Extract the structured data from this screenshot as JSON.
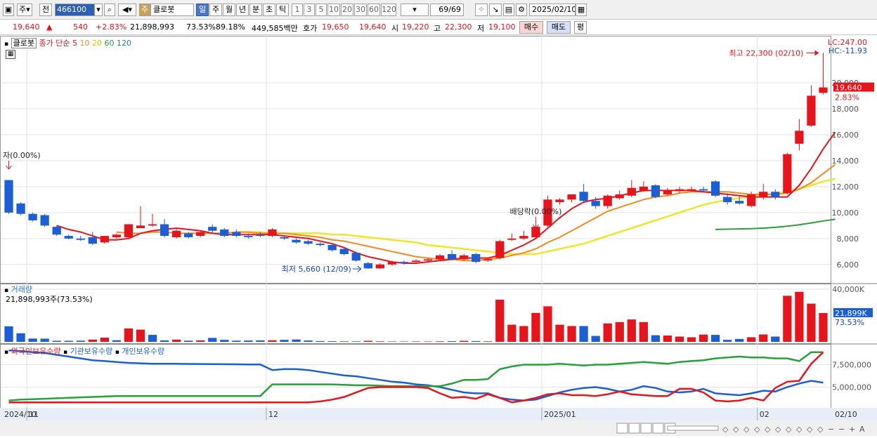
{
  "toolbar": {
    "type_label": "주",
    "prev_label": "전",
    "code": "466100",
    "stock_badge": "주",
    "stock_name": "클로봇",
    "periods": [
      "일",
      "주",
      "월",
      "년",
      "분",
      "초",
      "틱"
    ],
    "active_period": "일",
    "intervals": [
      "1",
      "3",
      "5",
      "10",
      "20",
      "30",
      "60",
      "120"
    ],
    "count": "69/69",
    "date": "2025/02/10"
  },
  "quote": {
    "price": "19,640",
    "change_arrow": "▲",
    "change": "540",
    "change_pct": "+2.83%",
    "volume": "21,898,993",
    "turnover_pct": "73.53%",
    "ratio": "89.18%",
    "amount": "449,585백만",
    "ask_label": "호가",
    "ask1": "19,650",
    "ask2": "19,640",
    "open_label": "시",
    "open": "19,220",
    "high_label": "고",
    "high": "22,300",
    "low_label": "저",
    "low": "19,100",
    "buy_label": "매수",
    "sell_label": "매도",
    "avg_label": "평"
  },
  "price_panel": {
    "name_label": "클로봇",
    "ma_title": "종가 단순",
    "ma_periods": [
      "5",
      "10",
      "20",
      "60",
      "120"
    ],
    "lc_label": "LC:247.00",
    "hc_label": "HC:-11.93",
    "high_annot": "최고 22,300 (02/10)",
    "low_annot": "최저 5,660 (12/09)",
    "start_annot": "자(0.00%)",
    "div_annot": "배당락(0.00%)",
    "last_price_tag": "19,640",
    "last_pct_tag": "2.83%"
  },
  "volume_panel": {
    "title": "거래량",
    "value_label": "21,898,993주(73.53%)",
    "axis_max": "40,000K",
    "last_tag": "21,899K",
    "last_pct": "73.53%"
  },
  "holding_panel": {
    "series_names": [
      "외국인보유수량",
      "기관보유수량",
      "개인보유수량"
    ]
  },
  "x_axis": {
    "labels": [
      "2024/10",
      "11",
      "12",
      "2025/01",
      "02",
      "02/10"
    ]
  },
  "colors": {
    "up": "#e8141c",
    "down": "#1a5fd6",
    "ma5": "#e8141c",
    "ma10": "#f08c1e",
    "ma20": "#f0e628",
    "ma60": "#28a03c",
    "ma120": "#1e78c8"
  },
  "chart_data": [
    {
      "type": "candlestick",
      "title": "클로봇",
      "ylim": [
        4800,
        23400
      ],
      "y_ticks": [
        6000,
        8000,
        10000,
        12000,
        14000,
        16000,
        18000,
        20000
      ],
      "candles": [
        {
          "o": 12500,
          "h": 12500,
          "c": 10000,
          "l": 9900
        },
        {
          "o": 10700,
          "h": 10800,
          "c": 9900,
          "l": 9800
        },
        {
          "o": 9900,
          "h": 10000,
          "c": 9400,
          "l": 9300
        },
        {
          "o": 9800,
          "h": 9900,
          "c": 9000,
          "l": 8900
        },
        {
          "o": 8900,
          "h": 9000,
          "c": 8300,
          "l": 8200
        },
        {
          "o": 8200,
          "h": 8300,
          "c": 8000,
          "l": 7950
        },
        {
          "o": 8000,
          "h": 8200,
          "c": 7900,
          "l": 7800
        },
        {
          "o": 8100,
          "h": 8500,
          "c": 7600,
          "l": 7500
        },
        {
          "o": 7700,
          "h": 8200,
          "c": 8200,
          "l": 7600
        },
        {
          "o": 8100,
          "h": 8400,
          "c": 8300,
          "l": 8000
        },
        {
          "o": 8100,
          "h": 8500,
          "c": 9100,
          "l": 8000
        },
        {
          "o": 8800,
          "h": 10500,
          "c": 9000,
          "l": 8800
        },
        {
          "o": 9000,
          "h": 9900,
          "c": 9100,
          "l": 8900
        },
        {
          "o": 9100,
          "h": 9500,
          "c": 8200,
          "l": 8100
        },
        {
          "o": 8100,
          "h": 8700,
          "c": 8600,
          "l": 8000
        },
        {
          "o": 8400,
          "h": 8500,
          "c": 8100,
          "l": 8000
        },
        {
          "o": 8200,
          "h": 8600,
          "c": 8500,
          "l": 8100
        },
        {
          "o": 8900,
          "h": 9100,
          "c": 8600,
          "l": 8400
        },
        {
          "o": 8700,
          "h": 8800,
          "c": 8200,
          "l": 8100
        },
        {
          "o": 8500,
          "h": 8700,
          "c": 8200,
          "l": 8100
        },
        {
          "o": 8200,
          "h": 8400,
          "c": 8100,
          "l": 8000
        },
        {
          "o": 8300,
          "h": 8500,
          "c": 8200,
          "l": 8100
        },
        {
          "o": 8200,
          "h": 8800,
          "c": 8700,
          "l": 8100
        },
        {
          "o": 8100,
          "h": 8200,
          "c": 8000,
          "l": 7900
        },
        {
          "o": 7900,
          "h": 8000,
          "c": 7700,
          "l": 7600
        },
        {
          "o": 7800,
          "h": 7900,
          "c": 7600,
          "l": 7500
        },
        {
          "o": 7600,
          "h": 7700,
          "c": 7500,
          "l": 7400
        },
        {
          "o": 7500,
          "h": 7600,
          "c": 7100,
          "l": 7000
        },
        {
          "o": 7200,
          "h": 7300,
          "c": 6800,
          "l": 6700
        },
        {
          "o": 6900,
          "h": 7000,
          "c": 6300,
          "l": 6200
        },
        {
          "o": 6100,
          "h": 6200,
          "c": 5700,
          "l": 5660
        },
        {
          "o": 5700,
          "h": 6100,
          "c": 6000,
          "l": 5660
        },
        {
          "o": 6000,
          "h": 6300,
          "c": 6200,
          "l": 5900
        },
        {
          "o": 6200,
          "h": 6300,
          "c": 6100,
          "l": 6000
        },
        {
          "o": 6200,
          "h": 6400,
          "c": 6300,
          "l": 6100
        },
        {
          "o": 6300,
          "h": 6500,
          "c": 6400,
          "l": 6200
        },
        {
          "o": 6400,
          "h": 6800,
          "c": 6700,
          "l": 6300
        },
        {
          "o": 6800,
          "h": 7100,
          "c": 6400,
          "l": 6300
        },
        {
          "o": 6400,
          "h": 6800,
          "c": 6700,
          "l": 6300
        },
        {
          "o": 6800,
          "h": 6900,
          "c": 6200,
          "l": 6100
        },
        {
          "o": 6300,
          "h": 6500,
          "c": 6400,
          "l": 6200
        },
        {
          "o": 6500,
          "h": 7900,
          "c": 7800,
          "l": 6400
        },
        {
          "o": 7900,
          "h": 8400,
          "c": 8000,
          "l": 7800
        },
        {
          "o": 8000,
          "h": 8600,
          "c": 8200,
          "l": 7900
        },
        {
          "o": 8100,
          "h": 9000,
          "c": 8900,
          "l": 8000
        },
        {
          "o": 9000,
          "h": 11300,
          "c": 11000,
          "l": 8900
        },
        {
          "o": 10800,
          "h": 11100,
          "c": 11000,
          "l": 10600
        },
        {
          "o": 11000,
          "h": 11400,
          "c": 11400,
          "l": 10800
        },
        {
          "o": 11600,
          "h": 12200,
          "c": 10900,
          "l": 10800
        },
        {
          "o": 10900,
          "h": 11200,
          "c": 10500,
          "l": 10300
        },
        {
          "o": 10500,
          "h": 11400,
          "c": 11300,
          "l": 10300
        },
        {
          "o": 11100,
          "h": 11700,
          "c": 11400,
          "l": 11000
        },
        {
          "o": 11300,
          "h": 12500,
          "c": 11900,
          "l": 11200
        },
        {
          "o": 11700,
          "h": 12400,
          "c": 12000,
          "l": 11600
        },
        {
          "o": 12100,
          "h": 12200,
          "c": 11200,
          "l": 11100
        },
        {
          "o": 11400,
          "h": 11900,
          "c": 11700,
          "l": 11300
        },
        {
          "o": 11700,
          "h": 12000,
          "c": 11800,
          "l": 11500
        },
        {
          "o": 11700,
          "h": 12000,
          "c": 11800,
          "l": 11600
        },
        {
          "o": 11800,
          "h": 12000,
          "c": 11700,
          "l": 11600
        },
        {
          "o": 12400,
          "h": 12500,
          "c": 11300,
          "l": 11200
        },
        {
          "o": 11200,
          "h": 11500,
          "c": 10800,
          "l": 10600
        },
        {
          "o": 10900,
          "h": 11300,
          "c": 10700,
          "l": 10600
        },
        {
          "o": 10500,
          "h": 11600,
          "c": 11400,
          "l": 10400
        },
        {
          "o": 11200,
          "h": 12200,
          "c": 11600,
          "l": 11000
        },
        {
          "o": 11600,
          "h": 11800,
          "c": 11200,
          "l": 11000
        },
        {
          "o": 11500,
          "h": 14600,
          "c": 14500,
          "l": 11400
        },
        {
          "o": 15300,
          "h": 17200,
          "c": 16300,
          "l": 14800
        },
        {
          "o": 16700,
          "h": 19800,
          "c": 19000,
          "l": 16600
        },
        {
          "o": 19220,
          "h": 22300,
          "c": 19640,
          "l": 19100
        }
      ],
      "ma5": [
        null,
        null,
        null,
        null,
        9000,
        8700,
        8500,
        8200,
        7900,
        7900,
        8000,
        8400,
        8600,
        8700,
        8800,
        8700,
        8600,
        8400,
        8300,
        8300,
        8300,
        8300,
        8300,
        8200,
        8100,
        8000,
        7800,
        7600,
        7300,
        6900,
        6600,
        6400,
        6200,
        6100,
        6100,
        6200,
        6300,
        6400,
        6500,
        6500,
        6500,
        6700,
        7100,
        7500,
        8000,
        8800,
        9600,
        10300,
        10800,
        11000,
        11100,
        11300,
        11500,
        11700,
        11700,
        11700,
        11700,
        11700,
        11600,
        11500,
        11400,
        11300,
        11200,
        11200,
        11200,
        11200,
        12100,
        13400,
        14900,
        16200
      ],
      "ma10": [
        null,
        null,
        null,
        null,
        null,
        null,
        null,
        null,
        null,
        8500,
        8400,
        8400,
        8500,
        8500,
        8400,
        8400,
        8400,
        8400,
        8400,
        8500,
        8500,
        8400,
        8400,
        8400,
        8300,
        8200,
        8100,
        7900,
        7800,
        7600,
        7400,
        7200,
        7000,
        6800,
        6600,
        6500,
        6400,
        6400,
        6300,
        6300,
        6400,
        6500,
        6700,
        6900,
        7200,
        7700,
        8100,
        8600,
        9100,
        9600,
        10100,
        10400,
        10700,
        11000,
        11200,
        11300,
        11500,
        11600,
        11600,
        11600,
        11600,
        11500,
        11400,
        11400,
        11400,
        11500,
        11800,
        12300,
        13000,
        13700
      ],
      "ma20": [
        null,
        null,
        null,
        null,
        null,
        null,
        null,
        null,
        null,
        null,
        null,
        null,
        null,
        null,
        null,
        null,
        null,
        null,
        null,
        8500,
        8500,
        8500,
        8400,
        8400,
        8400,
        8400,
        8400,
        8300,
        8300,
        8200,
        8100,
        8000,
        7900,
        7800,
        7700,
        7500,
        7400,
        7300,
        7200,
        7100,
        7000,
        6900,
        6800,
        6800,
        6800,
        7000,
        7200,
        7400,
        7600,
        7900,
        8200,
        8500,
        8800,
        9100,
        9400,
        9700,
        10000,
        10300,
        10600,
        10800,
        11000,
        11100,
        11300,
        11400,
        11400,
        11600,
        11800,
        12100,
        12400,
        12600
      ],
      "ma60": [
        null,
        null,
        null,
        null,
        null,
        null,
        null,
        null,
        null,
        null,
        null,
        null,
        null,
        null,
        null,
        null,
        null,
        null,
        null,
        null,
        null,
        null,
        null,
        null,
        null,
        null,
        null,
        null,
        null,
        null,
        null,
        null,
        null,
        null,
        null,
        null,
        null,
        null,
        null,
        null,
        null,
        null,
        null,
        null,
        null,
        null,
        null,
        null,
        null,
        null,
        null,
        null,
        null,
        null,
        null,
        null,
        null,
        null,
        null,
        8700,
        8720,
        8740,
        8760,
        8800,
        8860,
        8950,
        9060,
        9200,
        9350,
        9480
      ]
    },
    {
      "type": "bar",
      "title": "거래량",
      "ylim": [
        0,
        40000
      ],
      "values": [
        11800,
        6500,
        2500,
        2400,
        800,
        800,
        900,
        1700,
        3200,
        1200,
        10200,
        9300,
        5300,
        1100,
        1700,
        900,
        1100,
        3000,
        1500,
        900,
        1000,
        1100,
        1200,
        1500,
        1800,
        1000,
        600,
        500,
        400,
        400,
        800,
        400,
        300,
        300,
        300,
        300,
        400,
        500,
        800,
        600,
        400,
        32000,
        13000,
        12000,
        22000,
        27000,
        13000,
        12000,
        12000,
        4500,
        14000,
        15000,
        17000,
        15000,
        5000,
        4800,
        4000,
        3500,
        5500,
        5300,
        1500,
        2200,
        3500,
        5600,
        4000,
        35000,
        38000,
        29000,
        21899
      ],
      "up": [
        false,
        false,
        false,
        false,
        false,
        false,
        false,
        true,
        true,
        false,
        true,
        true,
        false,
        false,
        true,
        false,
        true,
        false,
        false,
        false,
        false,
        false,
        true,
        false,
        false,
        false,
        false,
        false,
        false,
        false,
        true,
        true,
        true,
        false,
        true,
        true,
        true,
        false,
        true,
        false,
        true,
        true,
        true,
        true,
        true,
        true,
        true,
        true,
        false,
        false,
        true,
        true,
        true,
        true,
        false,
        true,
        true,
        true,
        true,
        false,
        false,
        false,
        true,
        true,
        false,
        true,
        true,
        true,
        true
      ]
    },
    {
      "type": "line",
      "title": "",
      "ylim": [
        3000000,
        9500000
      ],
      "y_ticks": [
        5000000,
        7500000
      ],
      "y_tick_labels": [
        "5,000,000",
        "7,500,000"
      ],
      "series": [
        {
          "name": "외국인보유수량",
          "color": "#e8141c"
        },
        {
          "name": "기관보유수량",
          "color": "#1a5fd6"
        },
        {
          "name": "개인보유수량",
          "color": "#28a03c"
        }
      ],
      "x_end_index": 68
    }
  ]
}
